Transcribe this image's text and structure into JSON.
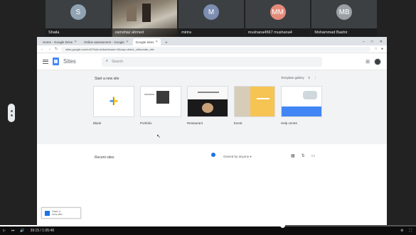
{
  "participants": [
    {
      "initial": "S",
      "name": "Shaila",
      "color": "#8fa3b3"
    },
    {
      "initial": "",
      "name": "zamshaz ahmed",
      "color": ""
    },
    {
      "initial": "M",
      "name": "mirira",
      "color": "#7c8db0"
    },
    {
      "initial": "MM",
      "name": "mushana4567 mushana4",
      "color": "#e58b7a"
    },
    {
      "initial": "MB",
      "name": "Mohammad Bashir",
      "color": "#9aa0a6"
    }
  ],
  "browser": {
    "tabs": [
      {
        "label": "Home - Google Drive",
        "active": false
      },
      {
        "label": "Online assessment - Google",
        "active": false
      },
      {
        "label": "Google Sites",
        "active": true
      }
    ],
    "new_tab": "+",
    "window_controls": [
      "–",
      "□",
      "✕"
    ],
    "url": "sites.google.com/u/0/?tab=cb&authuser=0&usp=direct_url#create_site"
  },
  "sites": {
    "title": "Sites",
    "search_placeholder": "Search",
    "start_heading": "Start a new site",
    "gallery_label": "Template gallery",
    "templates": [
      {
        "label": "Blank"
      },
      {
        "label": "Portfolio"
      },
      {
        "label": "Restaurant"
      },
      {
        "label": "Event"
      },
      {
        "label": "Help centre"
      }
    ],
    "recent_heading": "Recent sites",
    "owned_filter": "Owned by anyone ▾",
    "start_new_line1": "Start a",
    "start_new_line2": "new site"
  },
  "player": {
    "progress": 0.68,
    "time": "39:15 / 1:05:48",
    "left_icons": [
      "▷",
      "⏭",
      "🔊"
    ],
    "right_icons": [
      "⚙",
      "⛶"
    ]
  },
  "colors": {
    "accent": "#4285f4",
    "page_bg": "#202124"
  }
}
